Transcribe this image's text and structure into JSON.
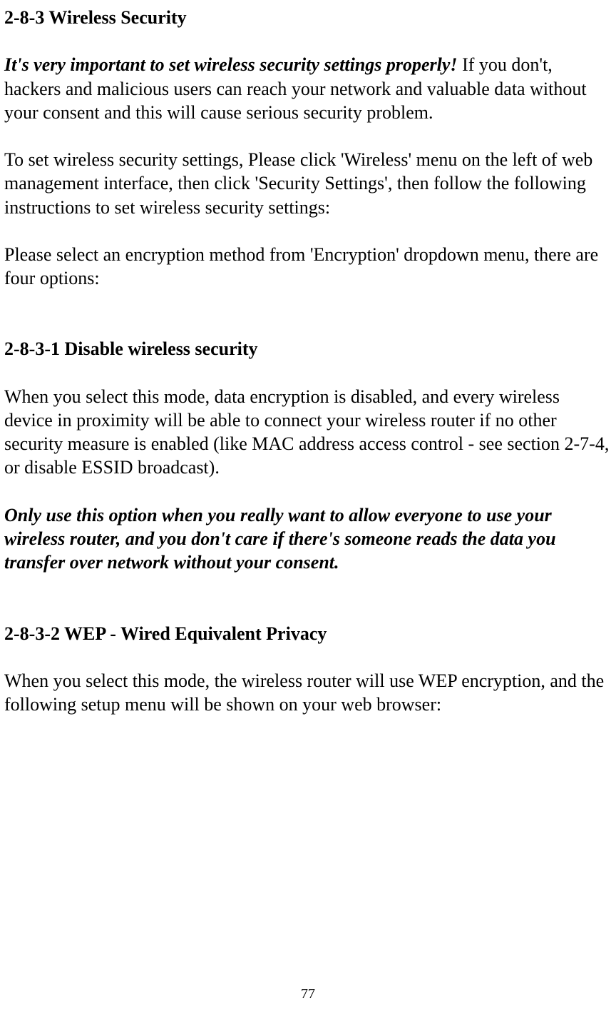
{
  "section_283": {
    "title": "2-8-3 Wireless Security",
    "intro_emphasis": "It's very important to set wireless security settings properly!",
    "intro_rest": " If you don't, hackers and malicious users can reach your network and valuable data without your consent and this will cause serious security problem.",
    "instructions": "To set wireless security settings, Please click 'Wireless' menu on the left of web management interface, then click 'Security Settings', then follow the following instructions to set wireless security settings:",
    "encryption_note": "Please select an encryption method from 'Encryption' dropdown menu, there are four options:"
  },
  "section_2831": {
    "title": "2-8-3-1 Disable wireless security",
    "body": "When you select this mode, data encryption is disabled, and every wireless device in proximity will be able to connect your wireless router if no other security measure is enabled (like MAC address access control - see section 2-7-4, or disable ESSID broadcast).",
    "warning": "Only use this option when you really want to allow everyone to use your wireless router, and you don't care if there's someone reads the data you transfer over network without your consent."
  },
  "section_2832": {
    "title": "2-8-3-2 WEP - Wired Equivalent Privacy",
    "body": "When you select this mode, the wireless router will use WEP encryption, and the following setup menu will be shown on your web browser:"
  },
  "page_number": "77"
}
